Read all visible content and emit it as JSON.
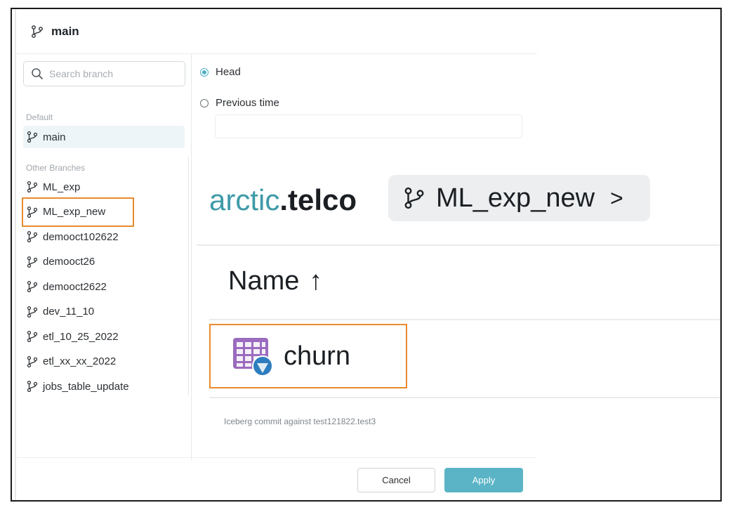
{
  "dialog": {
    "title": "main",
    "search": {
      "placeholder": "Search branch",
      "value": ""
    },
    "groups": {
      "default_label": "Default",
      "other_label": "Other Branches"
    },
    "default_branches": [
      "main"
    ],
    "other_branches": [
      "ML_exp",
      "ML_exp_new",
      "demooct102622",
      "demooct26",
      "demooct2622",
      "dev_11_10",
      "etl_10_25_2022",
      "etl_xx_xx_2022",
      "jobs_table_update"
    ],
    "options": {
      "head_label": "Head",
      "previous_label": "Previous time",
      "selected": "Head"
    },
    "commit_note": "Iceberg commit against test121822.test3",
    "buttons": {
      "cancel": "Cancel",
      "apply": "Apply"
    }
  },
  "zoom": {
    "brand_part1": "arctic",
    "brand_part2": ".telco",
    "breadcrumb_branch": "ML_exp_new",
    "breadcrumb_chevron": ">",
    "column_header": "Name",
    "sort_arrow": "↑",
    "row_name": "churn"
  },
  "colors": {
    "accent": "#4fb0c6",
    "apply_button": "#5ab4c6",
    "highlight_box": "#e88b2e",
    "brand_teal": "#3e9aa8",
    "table_icon": "#9b6bbf"
  },
  "icons": {
    "branch": "git-branch-icon",
    "search": "search-icon",
    "table": "iceberg-table-icon"
  }
}
